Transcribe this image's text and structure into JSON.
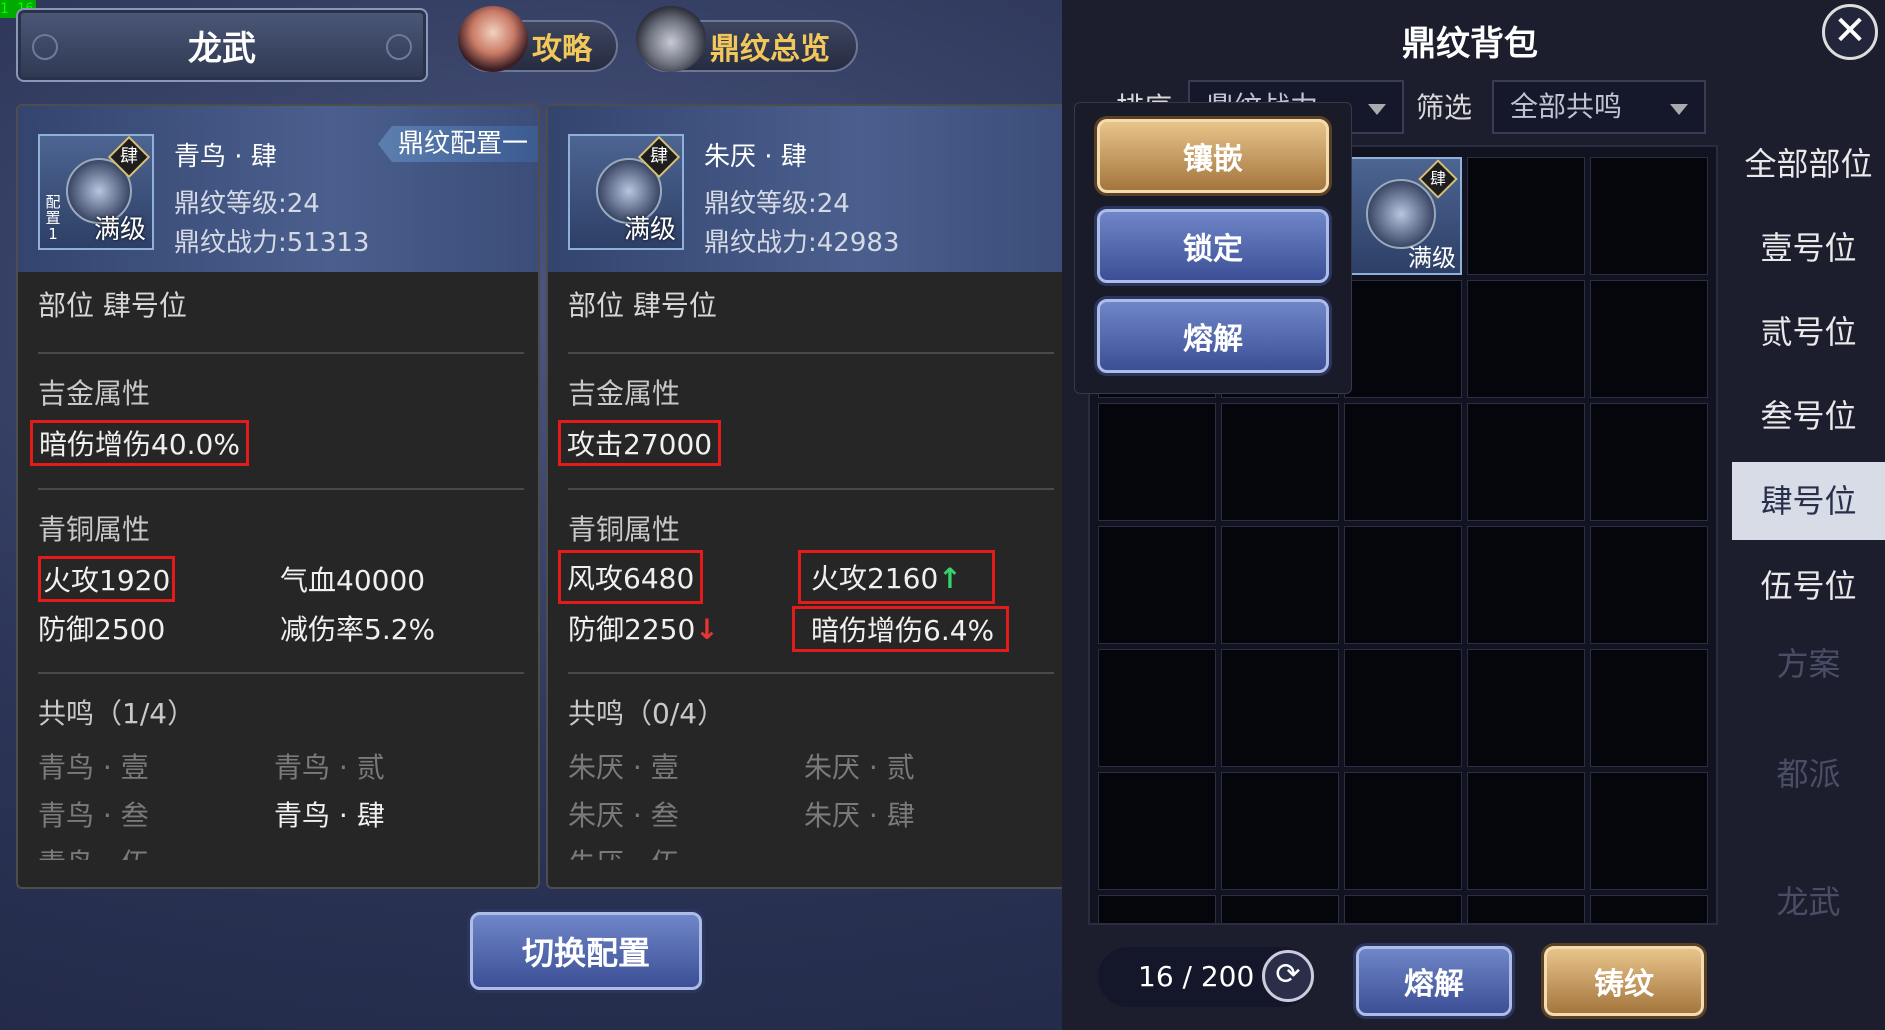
{
  "fps": "1 16",
  "header": {
    "title": "龙武",
    "guide_label": "攻略",
    "overview_label": "鼎纹总览"
  },
  "left_card": {
    "name": "青鸟 · 肆",
    "level": "鼎纹等级:24",
    "power": "鼎纹战力:51313",
    "tag": "鼎纹配置一",
    "gem_slot": "肆",
    "gem_level": "满级",
    "gem_cfg": "配置1",
    "position": "部位 肆号位",
    "gold_title": "吉金属性",
    "gold_attr": "暗伤增伤40.0%",
    "bronze_title": "青铜属性",
    "bronze": [
      {
        "label": "火攻1920"
      },
      {
        "label": "气血40000"
      },
      {
        "label": "防御2500"
      },
      {
        "label": "减伤率5.2%"
      }
    ],
    "resonance_title": "共鸣（1/4）",
    "resonance": [
      "青鸟 · 壹",
      "青鸟 · 贰",
      "青鸟 · 叁",
      "青鸟 · 肆"
    ],
    "resonance_more": "青鸟 · 伍"
  },
  "right_card": {
    "name": "朱厌 · 肆",
    "level": "鼎纹等级:24",
    "power": "鼎纹战力:42983",
    "gem_slot": "肆",
    "gem_level": "满级",
    "position": "部位 肆号位",
    "gold_title": "吉金属性",
    "gold_attr": "攻击27000",
    "bronze_title": "青铜属性",
    "bronze": [
      {
        "label": "风攻6480"
      },
      {
        "label": "火攻2160",
        "arrow": "↑"
      },
      {
        "label": "防御2250",
        "arrow": "↓"
      },
      {
        "label": "暗伤增伤6.4%"
      }
    ],
    "resonance_title": "共鸣（0/4）",
    "resonance": [
      "朱厌 · 壹",
      "朱厌 · 贰",
      "朱厌 · 叁",
      "朱厌 · 肆"
    ],
    "resonance_more": "朱厌 · 伍"
  },
  "switch_button": "切换配置",
  "bag": {
    "title": "鼎纹背包",
    "sort_label": "排序",
    "sort_value": "鼎纹战力",
    "filter_label": "筛选",
    "filter_value": "全部共鸣",
    "item": {
      "slot": "肆",
      "level": "满级"
    },
    "count": "16 / 200",
    "melt_button": "熔解",
    "forge_button": "铸纹",
    "categories": [
      "全部部位",
      "壹号位",
      "贰号位",
      "叁号位",
      "肆号位",
      "伍号位"
    ],
    "selected_category": "肆号位",
    "ghost_categories": [
      "方案",
      "都派",
      "龙武"
    ]
  },
  "popup": {
    "inlay": "镶嵌",
    "lock": "锁定",
    "melt": "熔解"
  },
  "colors": {
    "highlight_box": "#e21b1b",
    "arrow_up": "#37d36a",
    "arrow_down": "#e53535",
    "gold_text": "#f3c85a"
  }
}
